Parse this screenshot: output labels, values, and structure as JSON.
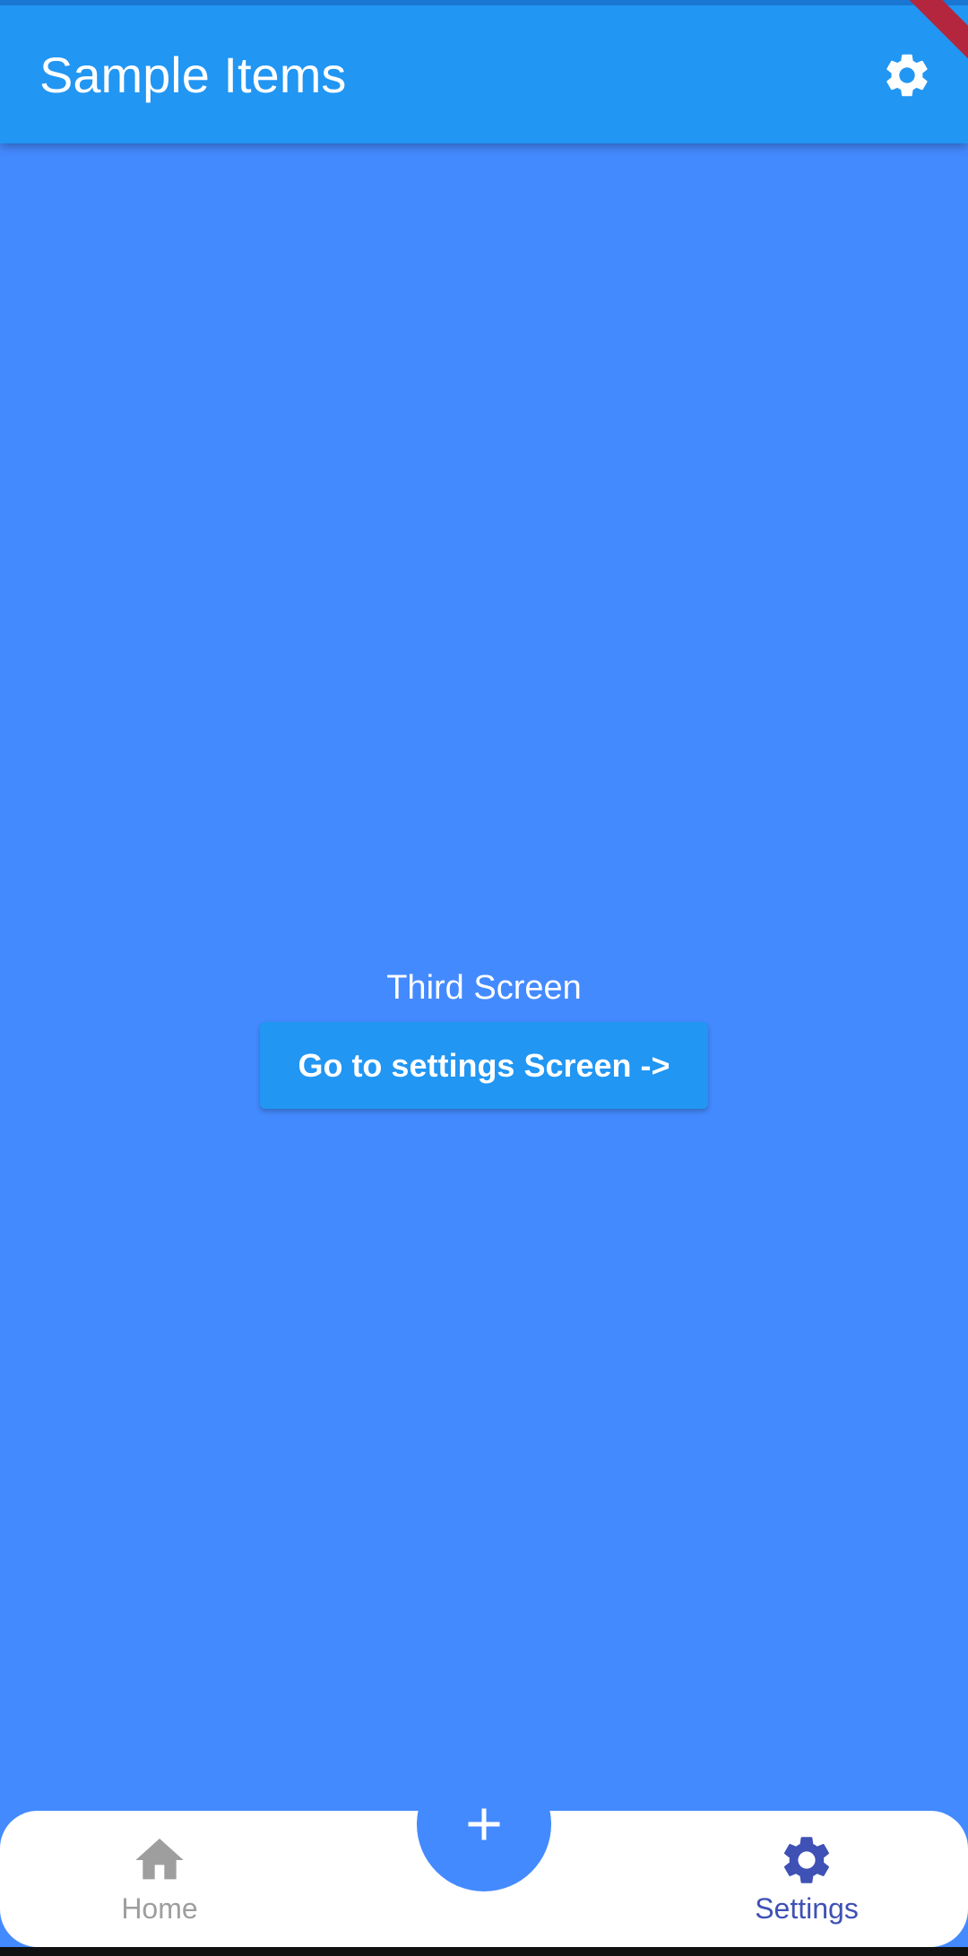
{
  "app_bar": {
    "title": "Sample Items",
    "action_icon": "gear-icon"
  },
  "content": {
    "screen_label": "Third Screen",
    "button_label": "Go to settings Screen ->"
  },
  "bottom_nav": {
    "items": [
      {
        "label": "Home",
        "icon": "home-icon",
        "selected": false
      },
      {
        "label": "Settings",
        "icon": "gear-icon",
        "selected": true
      }
    ],
    "fab_icon": "plus-icon"
  },
  "colors": {
    "background": "#448AFF",
    "app_bar": "#2196F3",
    "selected_nav": "#3F51B5",
    "unselected_nav": "#9E9E9E"
  }
}
